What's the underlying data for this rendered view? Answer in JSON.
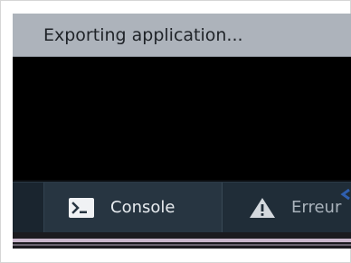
{
  "window": {
    "title": "Exporting application..."
  },
  "tabs": [
    {
      "label": "Console",
      "icon": "terminal-icon",
      "active": true
    },
    {
      "label": "Erreur",
      "icon": "warning-icon",
      "active": false
    }
  ],
  "colors": {
    "titlebar": "#adb3bb",
    "console_background": "#000000",
    "tabbar": "#1f2c37",
    "active_tab": "#273541",
    "accent_arrow": "#2f5fb0"
  }
}
